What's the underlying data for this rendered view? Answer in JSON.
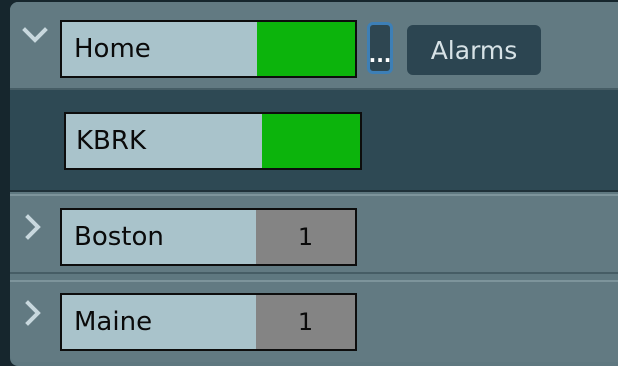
{
  "tree": {
    "home": {
      "label": "Home",
      "expanded": true,
      "status_color": "#0cb40c",
      "more_label": "...",
      "alarms_label": "Alarms"
    },
    "children": [
      {
        "label": "KBRK",
        "status_color": "#0cb40c"
      }
    ],
    "groups": [
      {
        "label": "Boston",
        "expanded": false,
        "alarm_count": "1"
      },
      {
        "label": "Maine",
        "expanded": false,
        "alarm_count": "1"
      }
    ]
  },
  "colors": {
    "ok": "#0cb40c",
    "count_bg": "#848484",
    "focus_outline": "#3d7fb6"
  }
}
